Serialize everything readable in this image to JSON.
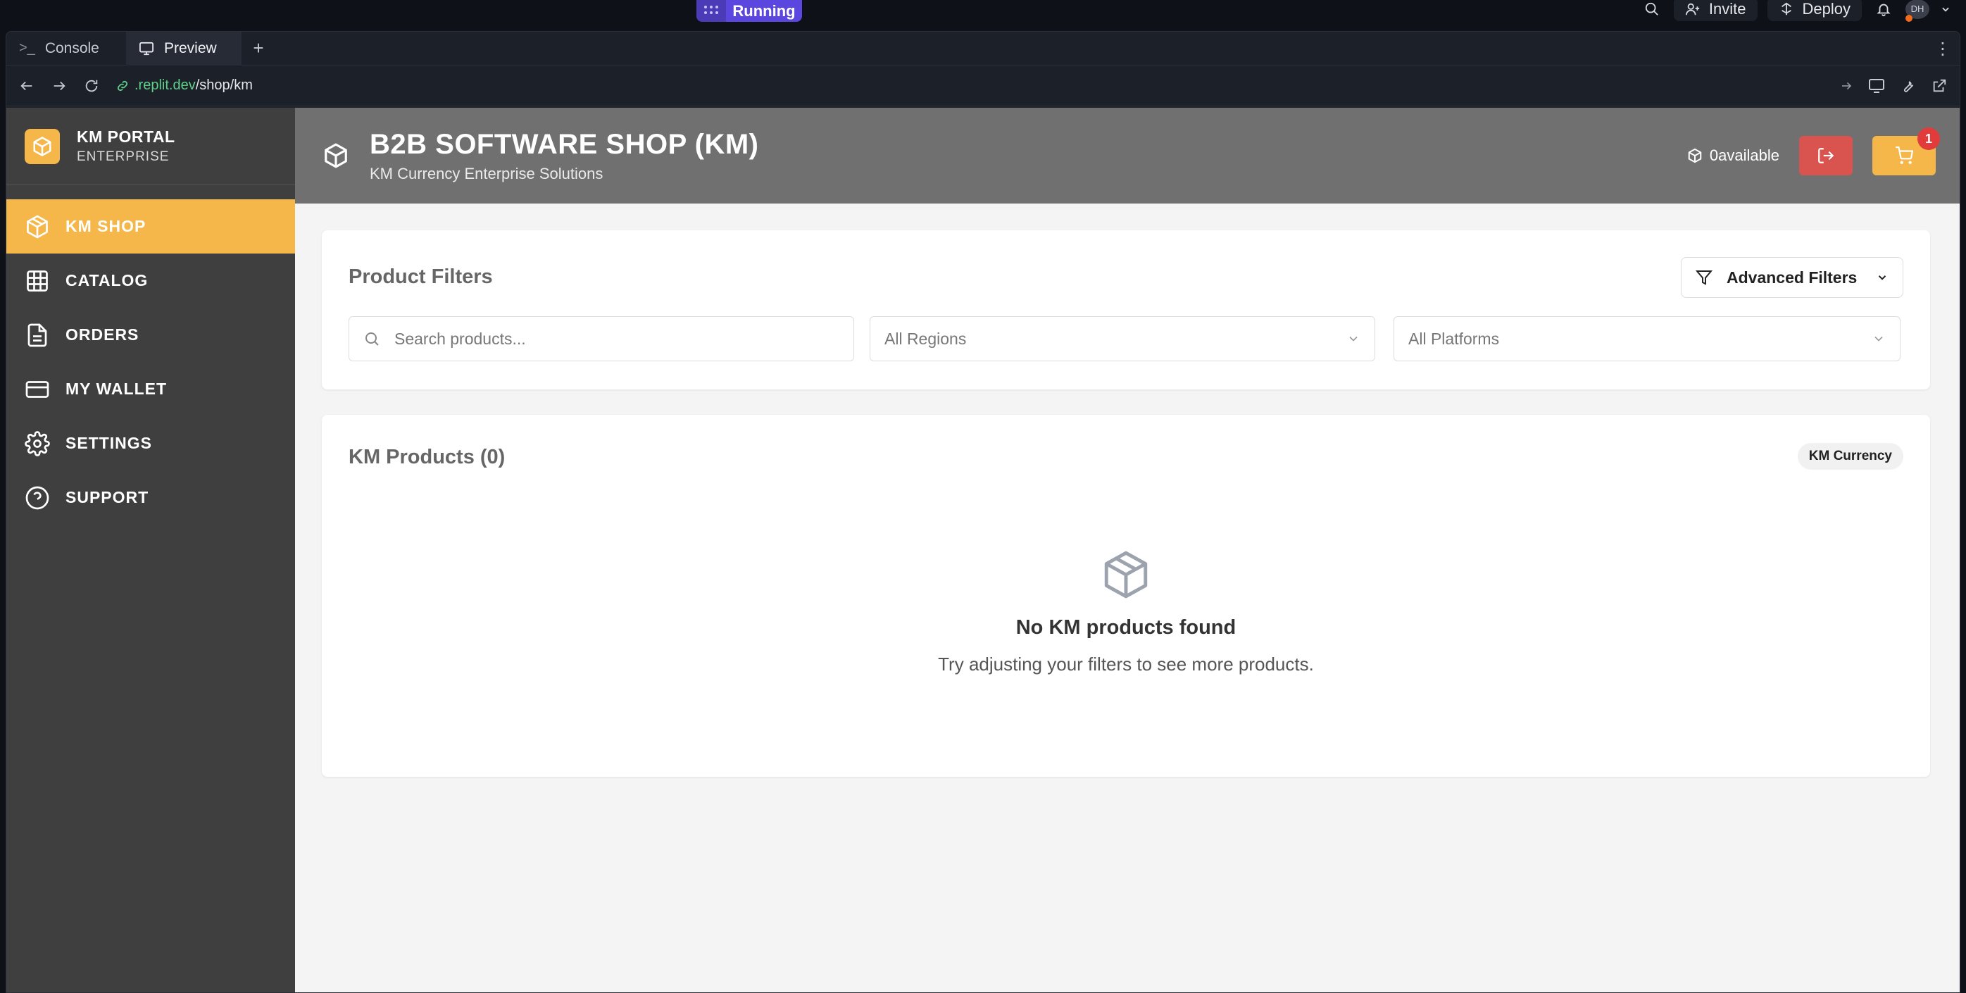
{
  "replit": {
    "run_status": "Running",
    "invite_label": "Invite",
    "deploy_label": "Deploy",
    "avatar_initials": "DH",
    "tabs": [
      {
        "label": "Console"
      },
      {
        "label": "Preview"
      }
    ],
    "new_tab": "+",
    "url_domain": ".replit.dev",
    "url_path": "/shop/km"
  },
  "sidebar": {
    "brand_title": "KM PORTAL",
    "brand_subtitle": "ENTERPRISE",
    "items": [
      {
        "label": "KM SHOP",
        "icon": "cube-icon",
        "active": true
      },
      {
        "label": "CATALOG",
        "icon": "grid-icon",
        "active": false
      },
      {
        "label": "ORDERS",
        "icon": "document-icon",
        "active": false
      },
      {
        "label": "MY WALLET",
        "icon": "wallet-icon",
        "active": false
      },
      {
        "label": "SETTINGS",
        "icon": "gear-icon",
        "active": false
      },
      {
        "label": "SUPPORT",
        "icon": "help-icon",
        "active": false
      }
    ]
  },
  "header": {
    "title": "B2B SOFTWARE SHOP (KM)",
    "subtitle": "KM Currency Enterprise Solutions",
    "available_value": "0",
    "available_label": "available",
    "cart_count": "1"
  },
  "filters": {
    "title": "Product Filters",
    "advanced_label": "Advanced Filters",
    "search_placeholder": "Search products...",
    "region_value": "All Regions",
    "platform_value": "All Platforms"
  },
  "products": {
    "title": "KM Products (0)",
    "currency_tag": "KM Currency",
    "empty_title": "No KM products found",
    "empty_subtitle": "Try adjusting your filters to see more products."
  },
  "colors": {
    "accent": "#f5b74a",
    "danger": "#d9534f",
    "sidebar_bg": "#3f3f3f",
    "header_bg": "#707070",
    "running": "#5b46e0"
  }
}
